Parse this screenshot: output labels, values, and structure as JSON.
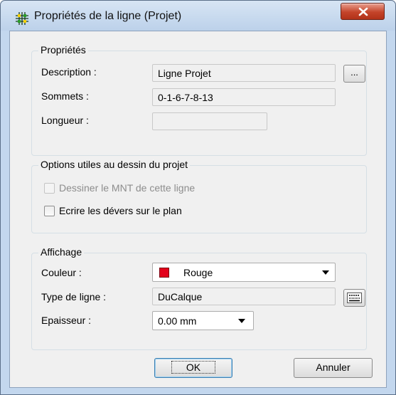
{
  "window": {
    "title": "Propriétés de la ligne (Projet)",
    "close_label": "X"
  },
  "proprietes": {
    "legend": "Propriétés",
    "description_label": "Description :",
    "description_value": "Ligne Projet",
    "browse_label": "...",
    "sommets_label": "Sommets :",
    "sommets_value": "0-1-6-7-8-13",
    "longueur_label": "Longueur :",
    "longueur_value": ""
  },
  "options": {
    "legend": "Options utiles au dessin du projet",
    "dessiner_mnt_label": "Dessiner le MNT de cette ligne",
    "dessiner_mnt_checked": false,
    "dessiner_mnt_enabled": false,
    "ecrire_devers_label": "Ecrire les dévers sur le plan",
    "ecrire_devers_checked": false
  },
  "affichage": {
    "legend": "Affichage",
    "couleur_label": "Couleur :",
    "couleur_value": "Rouge",
    "couleur_swatch": "#e3001b",
    "type_label": "Type de ligne :",
    "type_value": "DuCalque",
    "epaisseur_label": "Epaisseur :",
    "epaisseur_value": "0.00 mm"
  },
  "buttons": {
    "ok": "OK",
    "cancel": "Annuler"
  },
  "colors": {
    "title_bg": "#c3d7ee",
    "client_bg": "#f0f0f0",
    "close_red": "#c4442a"
  }
}
